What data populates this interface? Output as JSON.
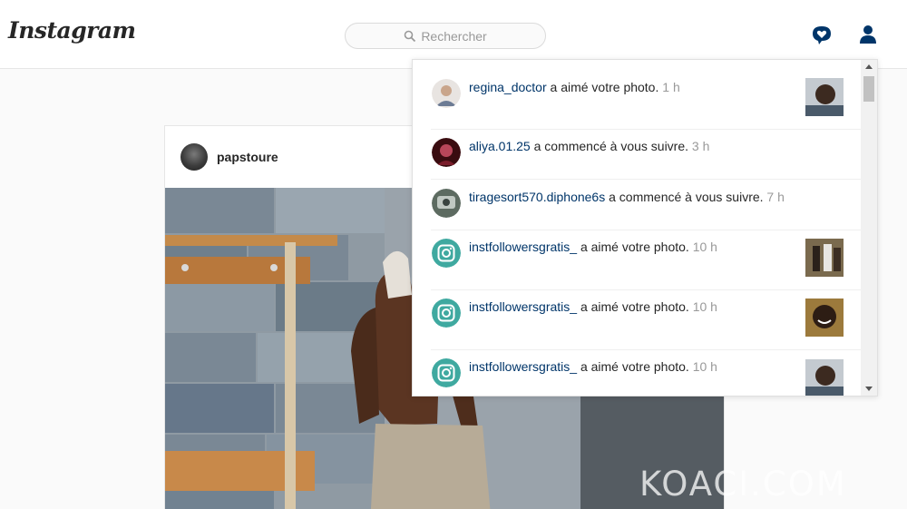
{
  "header": {
    "logo": "Instagram",
    "search_placeholder": "Rechercher"
  },
  "post": {
    "username": "papstoure"
  },
  "notifications": [
    {
      "user": "regina_doctor",
      "action": " a aimé votre photo. ",
      "time": "1 h",
      "has_thumb": true
    },
    {
      "user": "aliya.01.25",
      "action": " a commencé à vous suivre. ",
      "time": "3 h",
      "has_thumb": false
    },
    {
      "user": "tiragesort570.diphone6s",
      "action": " a commencé à vous suivre. ",
      "time": "7 h",
      "has_thumb": false
    },
    {
      "user": "instfollowersgratis_",
      "action": " a aimé votre photo. ",
      "time": "10 h",
      "has_thumb": true
    },
    {
      "user": "instfollowersgratis_",
      "action": " a aimé votre photo. ",
      "time": "10 h",
      "has_thumb": true
    },
    {
      "user": "instfollowersgratis_",
      "action": " a aimé votre photo. ",
      "time": "10 h",
      "has_thumb": true
    }
  ],
  "watermark": "KOACI.COM",
  "colors": {
    "link": "#003569",
    "muted": "#999999",
    "ig_teal": "#3fa9a0"
  }
}
